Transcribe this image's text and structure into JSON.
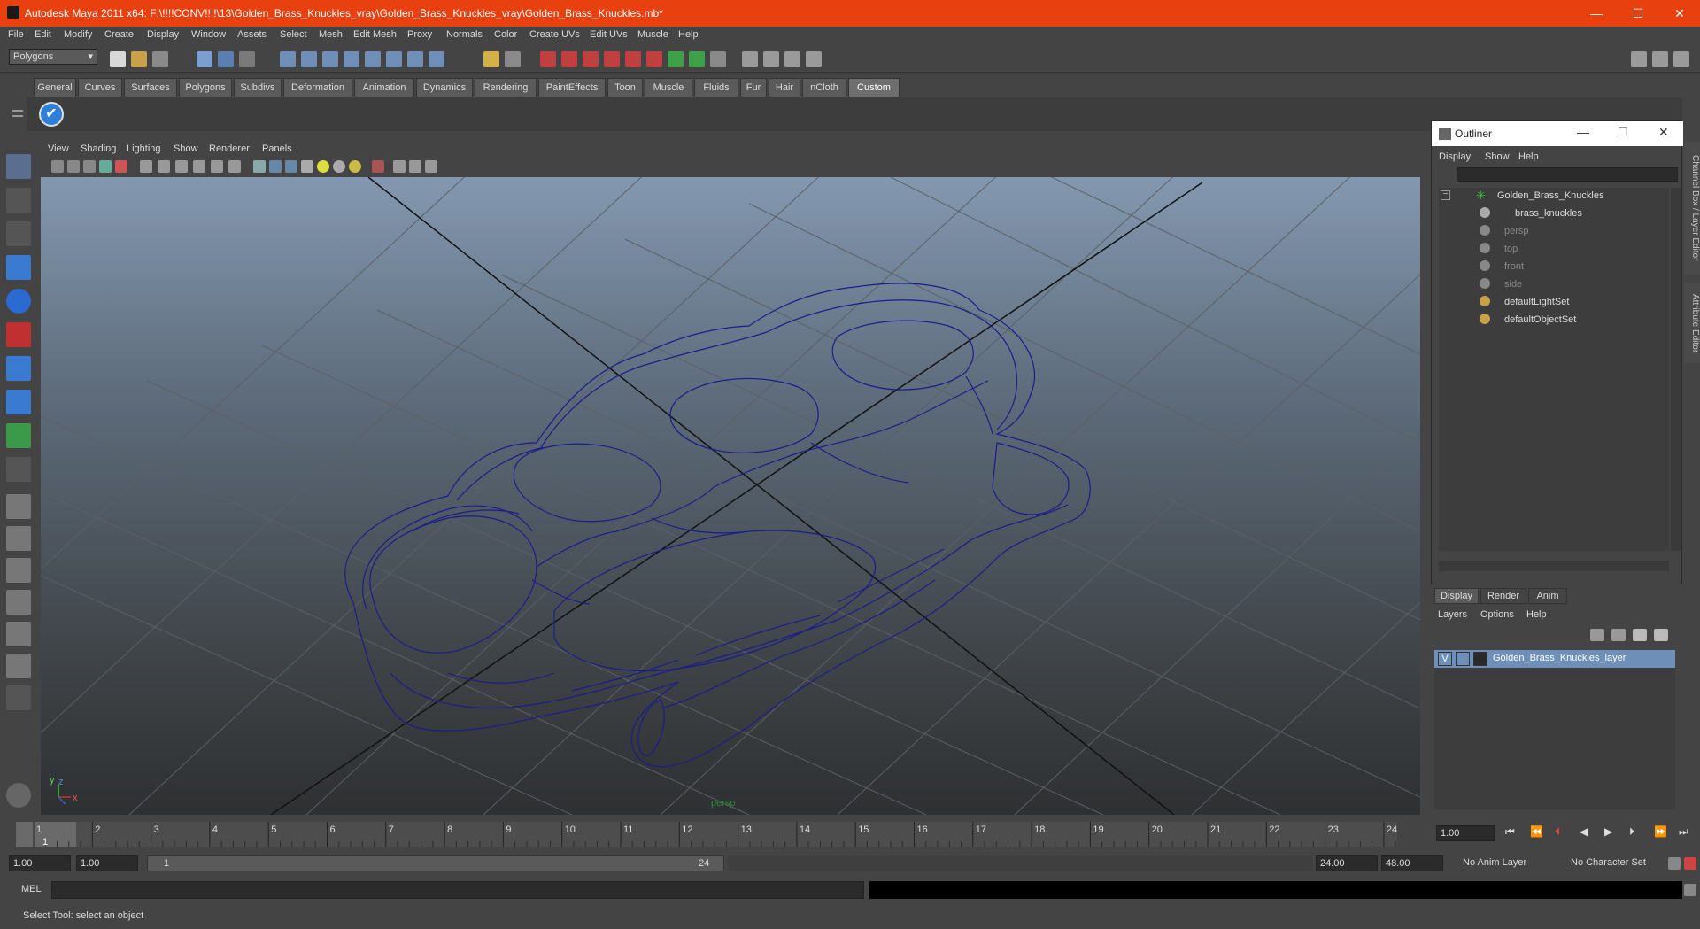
{
  "app": {
    "title": "Autodesk Maya 2011 x64: F:\\!!!!CONV!!!!\\13\\Golden_Brass_Knuckles_vray\\Golden_Brass_Knuckles_vray\\Golden_Brass_Knuckles.mb*",
    "window_controls": [
      "—",
      "☐",
      "✕"
    ]
  },
  "menubar": [
    "File",
    "Edit",
    "Modify",
    "Create",
    "Display",
    "Window",
    "Assets",
    "Select",
    "Mesh",
    "Edit Mesh",
    "Proxy",
    "Normals",
    "Color",
    "Create UVs",
    "Edit UVs",
    "Muscle",
    "Help"
  ],
  "status": {
    "mode": "Polygons"
  },
  "shelf_tabs": [
    "General",
    "Curves",
    "Surfaces",
    "Polygons",
    "Subdivs",
    "Deformation",
    "Animation",
    "Dynamics",
    "Rendering",
    "PaintEffects",
    "Toon",
    "Muscle",
    "Fluids",
    "Fur",
    "Hair",
    "nCloth",
    "Custom"
  ],
  "active_shelf_tab": "Custom",
  "viewport": {
    "menu": [
      "View",
      "Shading",
      "Lighting",
      "Show",
      "Renderer",
      "Panels"
    ],
    "camera_label": "persp",
    "axis": {
      "x": "x",
      "y": "y",
      "z": "z"
    }
  },
  "timeline": {
    "ticks": [
      "1",
      "2",
      "3",
      "4",
      "5",
      "6",
      "7",
      "8",
      "9",
      "10",
      "11",
      "12",
      "13",
      "14",
      "15",
      "16",
      "17",
      "18",
      "19",
      "20",
      "21",
      "22",
      "23",
      "24"
    ],
    "current_frame_marker": "1",
    "current_time": "1.00"
  },
  "range": {
    "start": "1.00",
    "anim_start": "1.00",
    "slider_start": "1",
    "slider_end": "24",
    "end": "24.00",
    "anim_end": "48.00",
    "anim_layer": "No Anim Layer",
    "character_set": "No Character Set"
  },
  "mel": {
    "label": "MEL"
  },
  "help_line": "Select Tool: select an object",
  "outliner": {
    "title": "Outliner",
    "menu": [
      "Display",
      "Show",
      "Help"
    ],
    "items": [
      {
        "label": "Golden_Brass_Knuckles",
        "dim": false,
        "indent": 0
      },
      {
        "label": "brass_knuckles",
        "dim": false,
        "indent": 1
      },
      {
        "label": "persp",
        "dim": true,
        "indent": 0
      },
      {
        "label": "top",
        "dim": true,
        "indent": 0
      },
      {
        "label": "front",
        "dim": true,
        "indent": 0
      },
      {
        "label": "side",
        "dim": true,
        "indent": 0
      },
      {
        "label": "defaultLightSet",
        "dim": false,
        "indent": 0
      },
      {
        "label": "defaultObjectSet",
        "dim": false,
        "indent": 0
      }
    ]
  },
  "layers": {
    "tabs": [
      "Display",
      "Render",
      "Anim"
    ],
    "menu": [
      "Layers",
      "Options",
      "Help"
    ],
    "layer_name": "Golden_Brass_Knuckles_layer",
    "visibility": "V"
  },
  "side_tabs": [
    "Channel Box / Layer Editor",
    "Attribute Editor"
  ]
}
